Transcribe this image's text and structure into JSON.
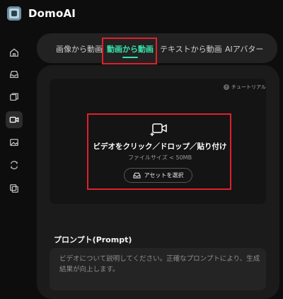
{
  "app": {
    "title": "DomoAI"
  },
  "sidebar": {
    "items": [
      {
        "icon": "home-icon"
      },
      {
        "icon": "inbox-icon"
      },
      {
        "icon": "gallery-icon"
      },
      {
        "icon": "video-icon",
        "active": true
      },
      {
        "icon": "image-icon"
      },
      {
        "icon": "refresh-icon"
      },
      {
        "icon": "layers-icon"
      }
    ]
  },
  "tabs": [
    {
      "label": "画像から動画"
    },
    {
      "label": "動画から動画",
      "active": true
    },
    {
      "label": "テキストから動画"
    },
    {
      "label": "AIアバター"
    }
  ],
  "upload": {
    "tutorial_label": "チュートリアル",
    "tutorial_glyph": "?",
    "title": "ビデオをクリック／ドロップ／貼り付け",
    "subtitle": "ファイルサイズ < 50MB",
    "select_asset_label": "アセットを選択"
  },
  "prompt": {
    "label": "プロンプト(Prompt)",
    "placeholder": "ビデオについて説明してください。正確なプロンプトにより、生成結果が向上します。"
  },
  "colors": {
    "accent": "#3be0a8",
    "highlight": "#e0202a",
    "background": "#0d0d0d"
  }
}
